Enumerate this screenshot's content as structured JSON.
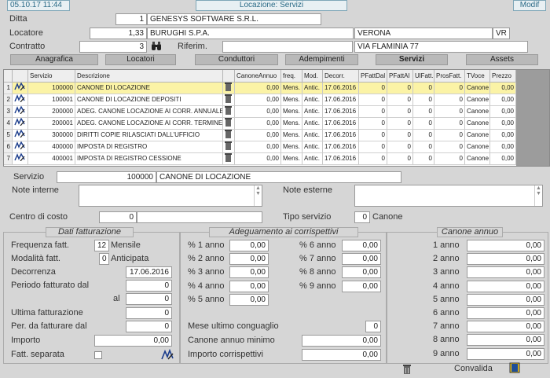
{
  "topbar": {
    "datetime": "05.10.17 11:44",
    "title": "Locazione: Servizi",
    "mode": "Modif"
  },
  "header": {
    "ditta_label": "Ditta",
    "ditta_code": "1",
    "ditta_name": "GENESYS SOFTWARE S.R.L.",
    "locatore_label": "Locatore",
    "locatore_code": "1,33",
    "locatore_name": "BURUGHI S.P.A.",
    "locatore_city": "VERONA",
    "locatore_prov": "VR",
    "contratto_label": "Contratto",
    "contratto_code": "3",
    "riferim_label": "Riferim.",
    "riferim_value": "",
    "address": "VIA FLAMINIA 77"
  },
  "tabs": [
    "Anagrafica",
    "Locatori",
    "Conduttori",
    "Adempimenti",
    "Servizi",
    "Assets"
  ],
  "grid": {
    "headers": [
      "Servizio",
      "Descrizione",
      "",
      "CanoneAnnuo",
      "freq.",
      "Mod.",
      "Decorr.",
      "PFattDal",
      "PFattAl",
      "UlFatt.",
      "ProsFatt.",
      "TVoce",
      "Prezzo"
    ],
    "rows": [
      [
        "1",
        "100000",
        "CANONE DI LOCAZIONE",
        "0,00",
        "Mens.",
        "Antic.",
        "17.06.2016",
        "0",
        "0",
        "0",
        "0",
        "Canone",
        "0,00"
      ],
      [
        "2",
        "100001",
        "CANONE DI LOCAZIONE DEPOSITI",
        "0,00",
        "Mens.",
        "Antic.",
        "17.06.2016",
        "0",
        "0",
        "0",
        "0",
        "Canone",
        "0,00"
      ],
      [
        "3",
        "200000",
        "ADEG. CANONE LOCAZIONE AI CORR. ANNUALE",
        "0,00",
        "Mens.",
        "Antic.",
        "17.06.2016",
        "0",
        "0",
        "0",
        "0",
        "Canone",
        "0,00"
      ],
      [
        "4",
        "200001",
        "ADEG. CANONE LOCAZIONE AI CORR. TERMINE",
        "0,00",
        "Mens.",
        "Antic.",
        "17.06.2016",
        "0",
        "0",
        "0",
        "0",
        "Canone",
        "0,00"
      ],
      [
        "5",
        "300000",
        "DIRITTI COPIE RILASCIATI DALL'UFFICIO",
        "0,00",
        "Mens.",
        "Antic.",
        "17.06.2016",
        "0",
        "0",
        "0",
        "0",
        "Canone",
        "0,00"
      ],
      [
        "6",
        "400000",
        "IMPOSTA DI REGISTRO",
        "0,00",
        "Mens.",
        "Antic.",
        "17.06.2016",
        "0",
        "0",
        "0",
        "0",
        "Canone",
        "0,00"
      ],
      [
        "7",
        "400001",
        "IMPOSTA DI REGISTRO CESSIONE",
        "0,00",
        "Mens.",
        "Antic.",
        "17.06.2016",
        "0",
        "0",
        "0",
        "0",
        "Canone",
        "0,00"
      ]
    ]
  },
  "detail": {
    "servizio_label": "Servizio",
    "servizio_code": "100000",
    "servizio_desc": "CANONE DI LOCAZIONE",
    "note_interne_label": "Note interne",
    "note_esterne_label": "Note esterne",
    "centro_label": "Centro di costo",
    "centro_code": "0",
    "centro_desc": "",
    "tipo_label": "Tipo servizio",
    "tipo_code": "0",
    "tipo_desc": "Canone"
  },
  "fatturazione": {
    "title": "Dati fatturazione",
    "freq_label": "Frequenza fatt.",
    "freq_code": "12",
    "freq_desc": "Mensile",
    "mod_label": "Modalità  fatt.",
    "mod_code": "0",
    "mod_desc": "Anticipata",
    "decorr_label": "Decorrenza",
    "decorr_value": "17.06.2016",
    "periodo_label": "Periodo fatturato dal",
    "periodo_dal": "0",
    "al_label": "al",
    "periodo_al": "0",
    "ultima_label": "Ultima fatturazione",
    "ultima_value": "0",
    "per_da_label": "Per. da fatturare dal",
    "per_da_value": "0",
    "importo_label": "Importo",
    "importo_value": "0,00",
    "separata_label": "Fatt. separata"
  },
  "adeguamento": {
    "title": "Adeguamento ai corrispettivi",
    "left": [
      [
        "% 1 anno",
        "0,00"
      ],
      [
        "% 2 anno",
        "0,00"
      ],
      [
        "% 3 anno",
        "0,00"
      ],
      [
        "% 4 anno",
        "0,00"
      ],
      [
        "% 5 anno",
        "0,00"
      ]
    ],
    "right": [
      [
        "% 6 anno",
        "0,00"
      ],
      [
        "% 7 anno",
        "0,00"
      ],
      [
        "% 8 anno",
        "0,00"
      ],
      [
        "% 9 anno",
        "0,00"
      ]
    ],
    "mese_label": "Mese ultimo conguaglio",
    "mese_value": "0",
    "minimo_label": "Canone annuo minimo",
    "minimo_value": "0,00",
    "importo_label": "Importo corrispettivi",
    "importo_value": "0,00"
  },
  "canone": {
    "title": "Canone annuo",
    "rows": [
      [
        "1 anno",
        "0,00"
      ],
      [
        "2 anno",
        "0,00"
      ],
      [
        "3 anno",
        "0,00"
      ],
      [
        "4 anno",
        "0,00"
      ],
      [
        "5 anno",
        "0,00"
      ],
      [
        "6 anno",
        "0,00"
      ],
      [
        "7 anno",
        "0,00"
      ],
      [
        "8 anno",
        "0,00"
      ],
      [
        "9 anno",
        "0,00"
      ]
    ]
  },
  "footer": {
    "convalida_label": "Convalida"
  }
}
